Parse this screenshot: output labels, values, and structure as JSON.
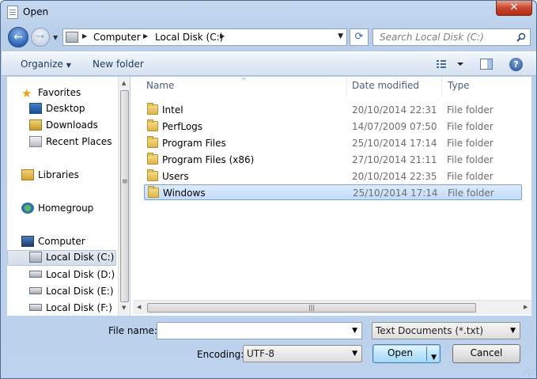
{
  "window": {
    "title": "Open",
    "close_label": "✕"
  },
  "navigation": {
    "back_glyph": "←",
    "forward_glyph": "→",
    "breadcrumb": [
      "Computer",
      "Local Disk (C:)"
    ],
    "refresh_glyph": "⟳",
    "search_placeholder": "Search Local Disk (C:)"
  },
  "toolbar": {
    "organize_label": "Organize",
    "new_folder_label": "New folder",
    "help_label": "?"
  },
  "sidebar": {
    "favorites": {
      "label": "Favorites"
    },
    "desktop": {
      "label": "Desktop"
    },
    "downloads": {
      "label": "Downloads"
    },
    "recent": {
      "label": "Recent Places"
    },
    "libraries": {
      "label": "Libraries"
    },
    "homegroup": {
      "label": "Homegroup"
    },
    "computer": {
      "label": "Computer"
    },
    "drives": [
      {
        "label": "Local Disk (C:)"
      },
      {
        "label": "Local Disk (D:)"
      },
      {
        "label": "Local Disk (E:)"
      },
      {
        "label": "Local Disk (F:)"
      }
    ]
  },
  "file_list": {
    "columns": {
      "name": "Name",
      "date": "Date modified",
      "type": "Type"
    },
    "rows": [
      {
        "name": "Intel",
        "date": "20/10/2014 22:31",
        "type": "File folder"
      },
      {
        "name": "PerfLogs",
        "date": "14/07/2009 07:50",
        "type": "File folder"
      },
      {
        "name": "Program Files",
        "date": "25/10/2014 17:14",
        "type": "File folder"
      },
      {
        "name": "Program Files (x86)",
        "date": "27/10/2014 21:11",
        "type": "File folder"
      },
      {
        "name": "Users",
        "date": "20/10/2014 22:35",
        "type": "File folder"
      },
      {
        "name": "Windows",
        "date": "25/10/2014 17:14",
        "type": "File folder"
      }
    ],
    "selected_row": "Windows"
  },
  "footer": {
    "file_name_label": "File name:",
    "file_name_value": "",
    "file_type_value": "Text Documents (*.txt)",
    "encoding_label": "Encoding:",
    "encoding_value": "UTF-8",
    "open_label": "Open",
    "cancel_label": "Cancel"
  }
}
